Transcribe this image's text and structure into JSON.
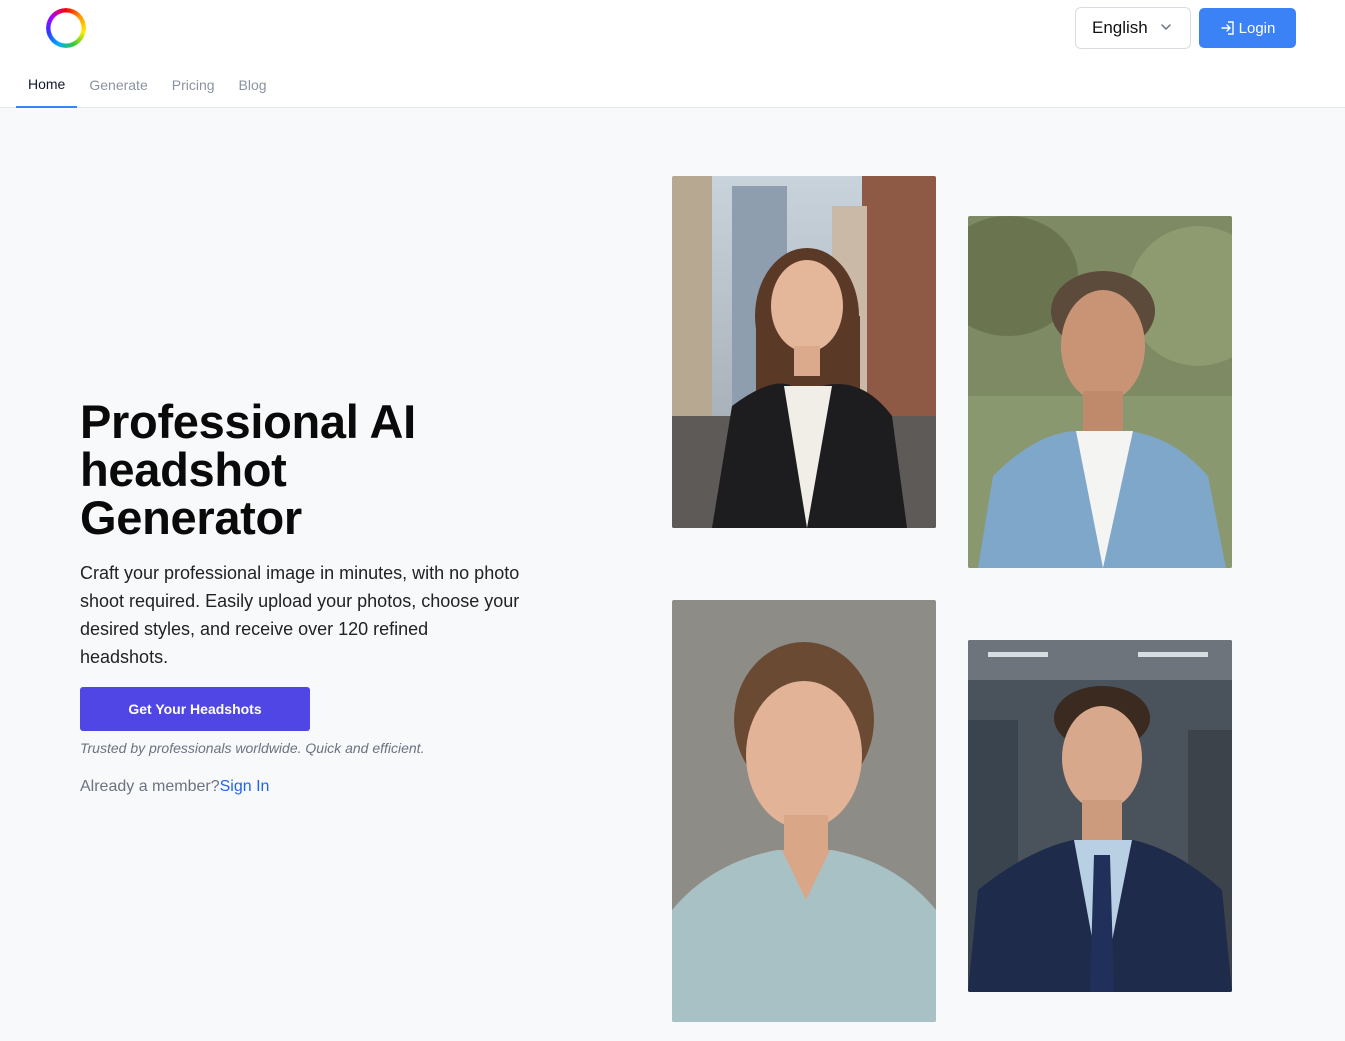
{
  "header": {
    "language": {
      "selected": "English"
    },
    "login_label": "Login"
  },
  "nav": {
    "tabs": [
      {
        "label": "Home",
        "active": true
      },
      {
        "label": "Generate",
        "active": false
      },
      {
        "label": "Pricing",
        "active": false
      },
      {
        "label": "Blog",
        "active": false
      }
    ]
  },
  "hero": {
    "title_lines": [
      "Professional AI",
      "headshot",
      "Generator"
    ],
    "description": "Craft your professional image in minutes, with no photo shoot required. Easily upload your photos, choose your desired styles, and receive over 120 refined headshots.",
    "cta_label": "Get Your Headshots",
    "trust_text": "Trusted by professionals worldwide. Quick and efficient.",
    "member_text": "Already a member?",
    "signin_label": "Sign In"
  },
  "colors": {
    "accent_blue": "#3b82f6",
    "cta_indigo": "#4f46e5",
    "link_blue": "#2563eb"
  },
  "icons": {
    "language_chevron": "chevron-down-icon",
    "login": "login-icon"
  }
}
